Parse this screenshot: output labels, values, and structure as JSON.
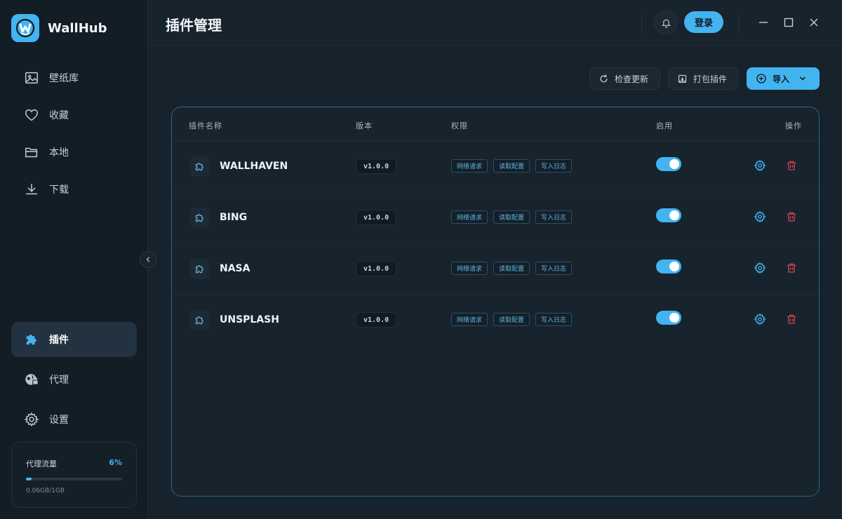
{
  "app": {
    "name": "WallHub"
  },
  "sidebar": {
    "items": [
      {
        "label": "壁纸库",
        "icon": "image-icon"
      },
      {
        "label": "收藏",
        "icon": "heart-icon"
      },
      {
        "label": "本地",
        "icon": "folder-icon"
      },
      {
        "label": "下载",
        "icon": "download-icon"
      }
    ],
    "bottom_items": [
      {
        "label": "插件",
        "icon": "puzzle-icon",
        "active": true
      },
      {
        "label": "代理",
        "icon": "globe-lock-icon"
      },
      {
        "label": "设置",
        "icon": "gear-icon"
      }
    ],
    "traffic": {
      "label": "代理流量",
      "percent_text": "6%",
      "percent": 6,
      "used": "0.06GB/1GB"
    }
  },
  "header": {
    "title": "插件管理",
    "login_label": "登录"
  },
  "toolbar": {
    "check_update": "检查更新",
    "pack": "打包插件",
    "import": "导入"
  },
  "table": {
    "columns": {
      "name": "插件名称",
      "version": "版本",
      "permissions": "权限",
      "enabled": "启用",
      "actions": "操作"
    },
    "rows": [
      {
        "name": "WALLHAVEN",
        "version": "v1.0.0",
        "perms": [
          "网络请求",
          "读取配置",
          "写入日志"
        ],
        "enabled": true
      },
      {
        "name": "BING",
        "version": "v1.0.0",
        "perms": [
          "网络请求",
          "读取配置",
          "写入日志"
        ],
        "enabled": true
      },
      {
        "name": "NASA",
        "version": "v1.0.0",
        "perms": [
          "网络请求",
          "读取配置",
          "写入日志"
        ],
        "enabled": true
      },
      {
        "name": "UNSPLASH",
        "version": "v1.0.0",
        "perms": [
          "网络请求",
          "读取配置",
          "写入日志"
        ],
        "enabled": true
      }
    ]
  },
  "colors": {
    "accent": "#43b4f0",
    "danger": "#d9414b",
    "background": "#16222c",
    "sidebar": "#131d26"
  }
}
